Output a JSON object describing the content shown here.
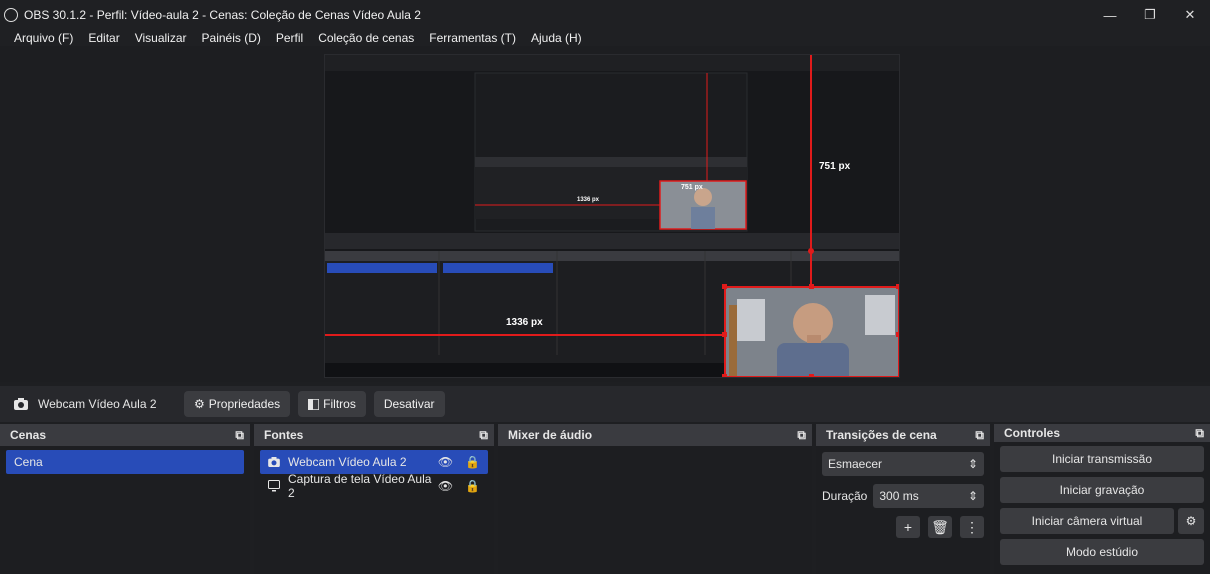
{
  "window": {
    "title": "OBS 30.1.2 - Perfil: Vídeo-aula 2 - Cenas: Coleção de Cenas Vídeo Aula 2",
    "controls": [
      "—",
      "❐",
      "✕"
    ]
  },
  "menu": [
    "Arquivo (F)",
    "Editar",
    "Visualizar",
    "Painéis (D)",
    "Perfil",
    "Coleção de cenas",
    "Ferramentas (T)",
    "Ajuda (H)"
  ],
  "preview": {
    "label_vertical": "751 px",
    "label_horizontal": "1336 px",
    "inner_label_vertical": "751 px",
    "inner_label_horizontal": "1336 px",
    "accent": "#e01b1b"
  },
  "context_bar": {
    "source_name": "Webcam Vídeo Aula 2",
    "properties": "Propriedades",
    "filters": "Filtros",
    "deactivate": "Desativar"
  },
  "scenes": {
    "title": "Cenas",
    "items": [
      "Cena"
    ]
  },
  "sources": {
    "title": "Fontes",
    "items": [
      "Webcam Vídeo Aula 2",
      "Captura de tela Vídeo Aula 2"
    ]
  },
  "mixer": {
    "title": "Mixer de áudio"
  },
  "transitions": {
    "title": "Transições de cena",
    "selected": "Esmaecer",
    "duration_label": "Duração",
    "duration_value": "300 ms"
  },
  "controls": {
    "title": "Controles",
    "start_stream": "Iniciar transmissão",
    "start_record": "Iniciar gravação",
    "virtual_cam": "Iniciar câmera virtual",
    "studio_mode": "Modo estúdio"
  }
}
